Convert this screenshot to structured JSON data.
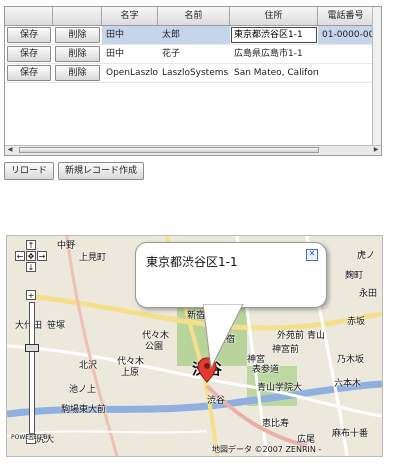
{
  "grid": {
    "headers": [
      "",
      "",
      "名字",
      "名前",
      "住所",
      "電話番号"
    ],
    "rows": [
      {
        "save": "保存",
        "delete": "削除",
        "sei": "田中",
        "mei": "太郎",
        "address": "東京都渋谷区1-1",
        "phone": "01-0000-00"
      },
      {
        "save": "保存",
        "delete": "削除",
        "sei": "田中",
        "mei": "花子",
        "address": "広島県広島市1-1",
        "phone": ""
      },
      {
        "save": "保存",
        "delete": "削除",
        "sei": "OpenLaszlo",
        "mei": "LaszloSystems",
        "address": "San Mateo, Californ",
        "phone": ""
      }
    ]
  },
  "buttons": {
    "reload": "リロード",
    "new_record": "新規レコード作成"
  },
  "map": {
    "bubble_text": "東京都渋谷区1-1",
    "close_glyph": "✕",
    "zoom_in": "+",
    "zoom_out": "−",
    "pan_up": "↑",
    "pan_down": "↓",
    "pan_left": "←",
    "pan_right": "→",
    "center": "✥",
    "copyright": "地図データ ©2007 ZENRIN -",
    "powered": "POWERED BY",
    "labels": {
      "nakano": "中野",
      "kamiya": "上見町",
      "sasazuka": "笹塚",
      "daita": "大代田",
      "yoyogi": "代々木",
      "koen": "公園",
      "yoyogi2": "代々木",
      "uehara": "上原",
      "kitazawa": "北沢",
      "ikenoue": "池ノ上",
      "komaba": "駒場東大前",
      "shibuya_big": "渋谷",
      "shibuya": "渋谷",
      "harajuku": "原宿",
      "jingumae": "神宮前",
      "gaien": "外苑前",
      "omotesando": "表参道",
      "aoyama": "青山",
      "nogizaka": "乃木坂",
      "roppongi": "六本木",
      "akasaka": "赤坂",
      "hiroo": "広尾",
      "azabu": "麻布十番",
      "ebisu": "恵比寿",
      "nagata": "永田",
      "toranomon": "虎ノ",
      "kojimachi": "麹町",
      "ikejiri": "池尻大",
      "aoyama_park": "青山学院大",
      "kanda": "神宮",
      "shinjuku": "新宿"
    }
  }
}
